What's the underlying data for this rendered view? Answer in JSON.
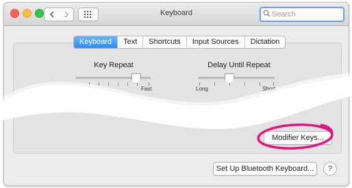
{
  "window": {
    "title": "Keyboard"
  },
  "search": {
    "placeholder": "Search"
  },
  "tabs": [
    {
      "label": "Keyboard",
      "selected": true
    },
    {
      "label": "Text",
      "selected": false
    },
    {
      "label": "Shortcuts",
      "selected": false
    },
    {
      "label": "Input Sources",
      "selected": false
    },
    {
      "label": "Dictation",
      "selected": false
    }
  ],
  "key_repeat": {
    "label": "Key Repeat",
    "max_label": "Fast",
    "value_fraction": 0.8
  },
  "delay_until_repeat": {
    "label": "Delay Until Repeat",
    "min_label": "Long",
    "max_label": "Short",
    "value_fraction": 0.4
  },
  "buttons": {
    "modifier_keys": "Modifier Keys...",
    "bluetooth": "Set Up Bluetooth Keyboard...",
    "help": "?"
  },
  "colors": {
    "accent": "#2a8cf7",
    "highlight_circle": "#e0157f"
  }
}
